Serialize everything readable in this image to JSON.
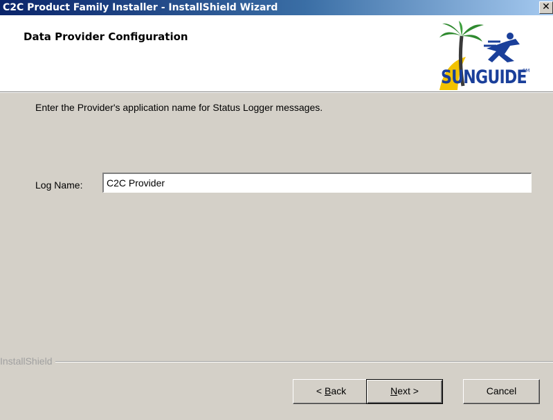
{
  "window": {
    "title": "C2C Product Family Installer - InstallShield Wizard",
    "close_symbol": "✕"
  },
  "header": {
    "title": "Data Provider Configuration",
    "logo": {
      "icon": "palm-tree-runner-logo",
      "text": "SUNGUIDE",
      "tm": "SM"
    }
  },
  "content": {
    "instruction": "Enter the Provider's application name for Status Logger messages.",
    "log_name_label": "Log Name:",
    "log_name_value": "C2C Provider"
  },
  "footer": {
    "brand": "InstallShield",
    "buttons": {
      "back_prefix": "< ",
      "back_mnemonic": "B",
      "back_rest": "ack",
      "next_mnemonic": "N",
      "next_rest": "ext >",
      "cancel": "Cancel"
    }
  },
  "colors": {
    "titlebar_start": "#0a246a",
    "titlebar_end": "#a6caf0",
    "dialog_bg": "#d4d0c8",
    "logo_blue": "#1a3f9a",
    "logo_green": "#2f8a2f",
    "logo_yellow": "#f2c200"
  }
}
